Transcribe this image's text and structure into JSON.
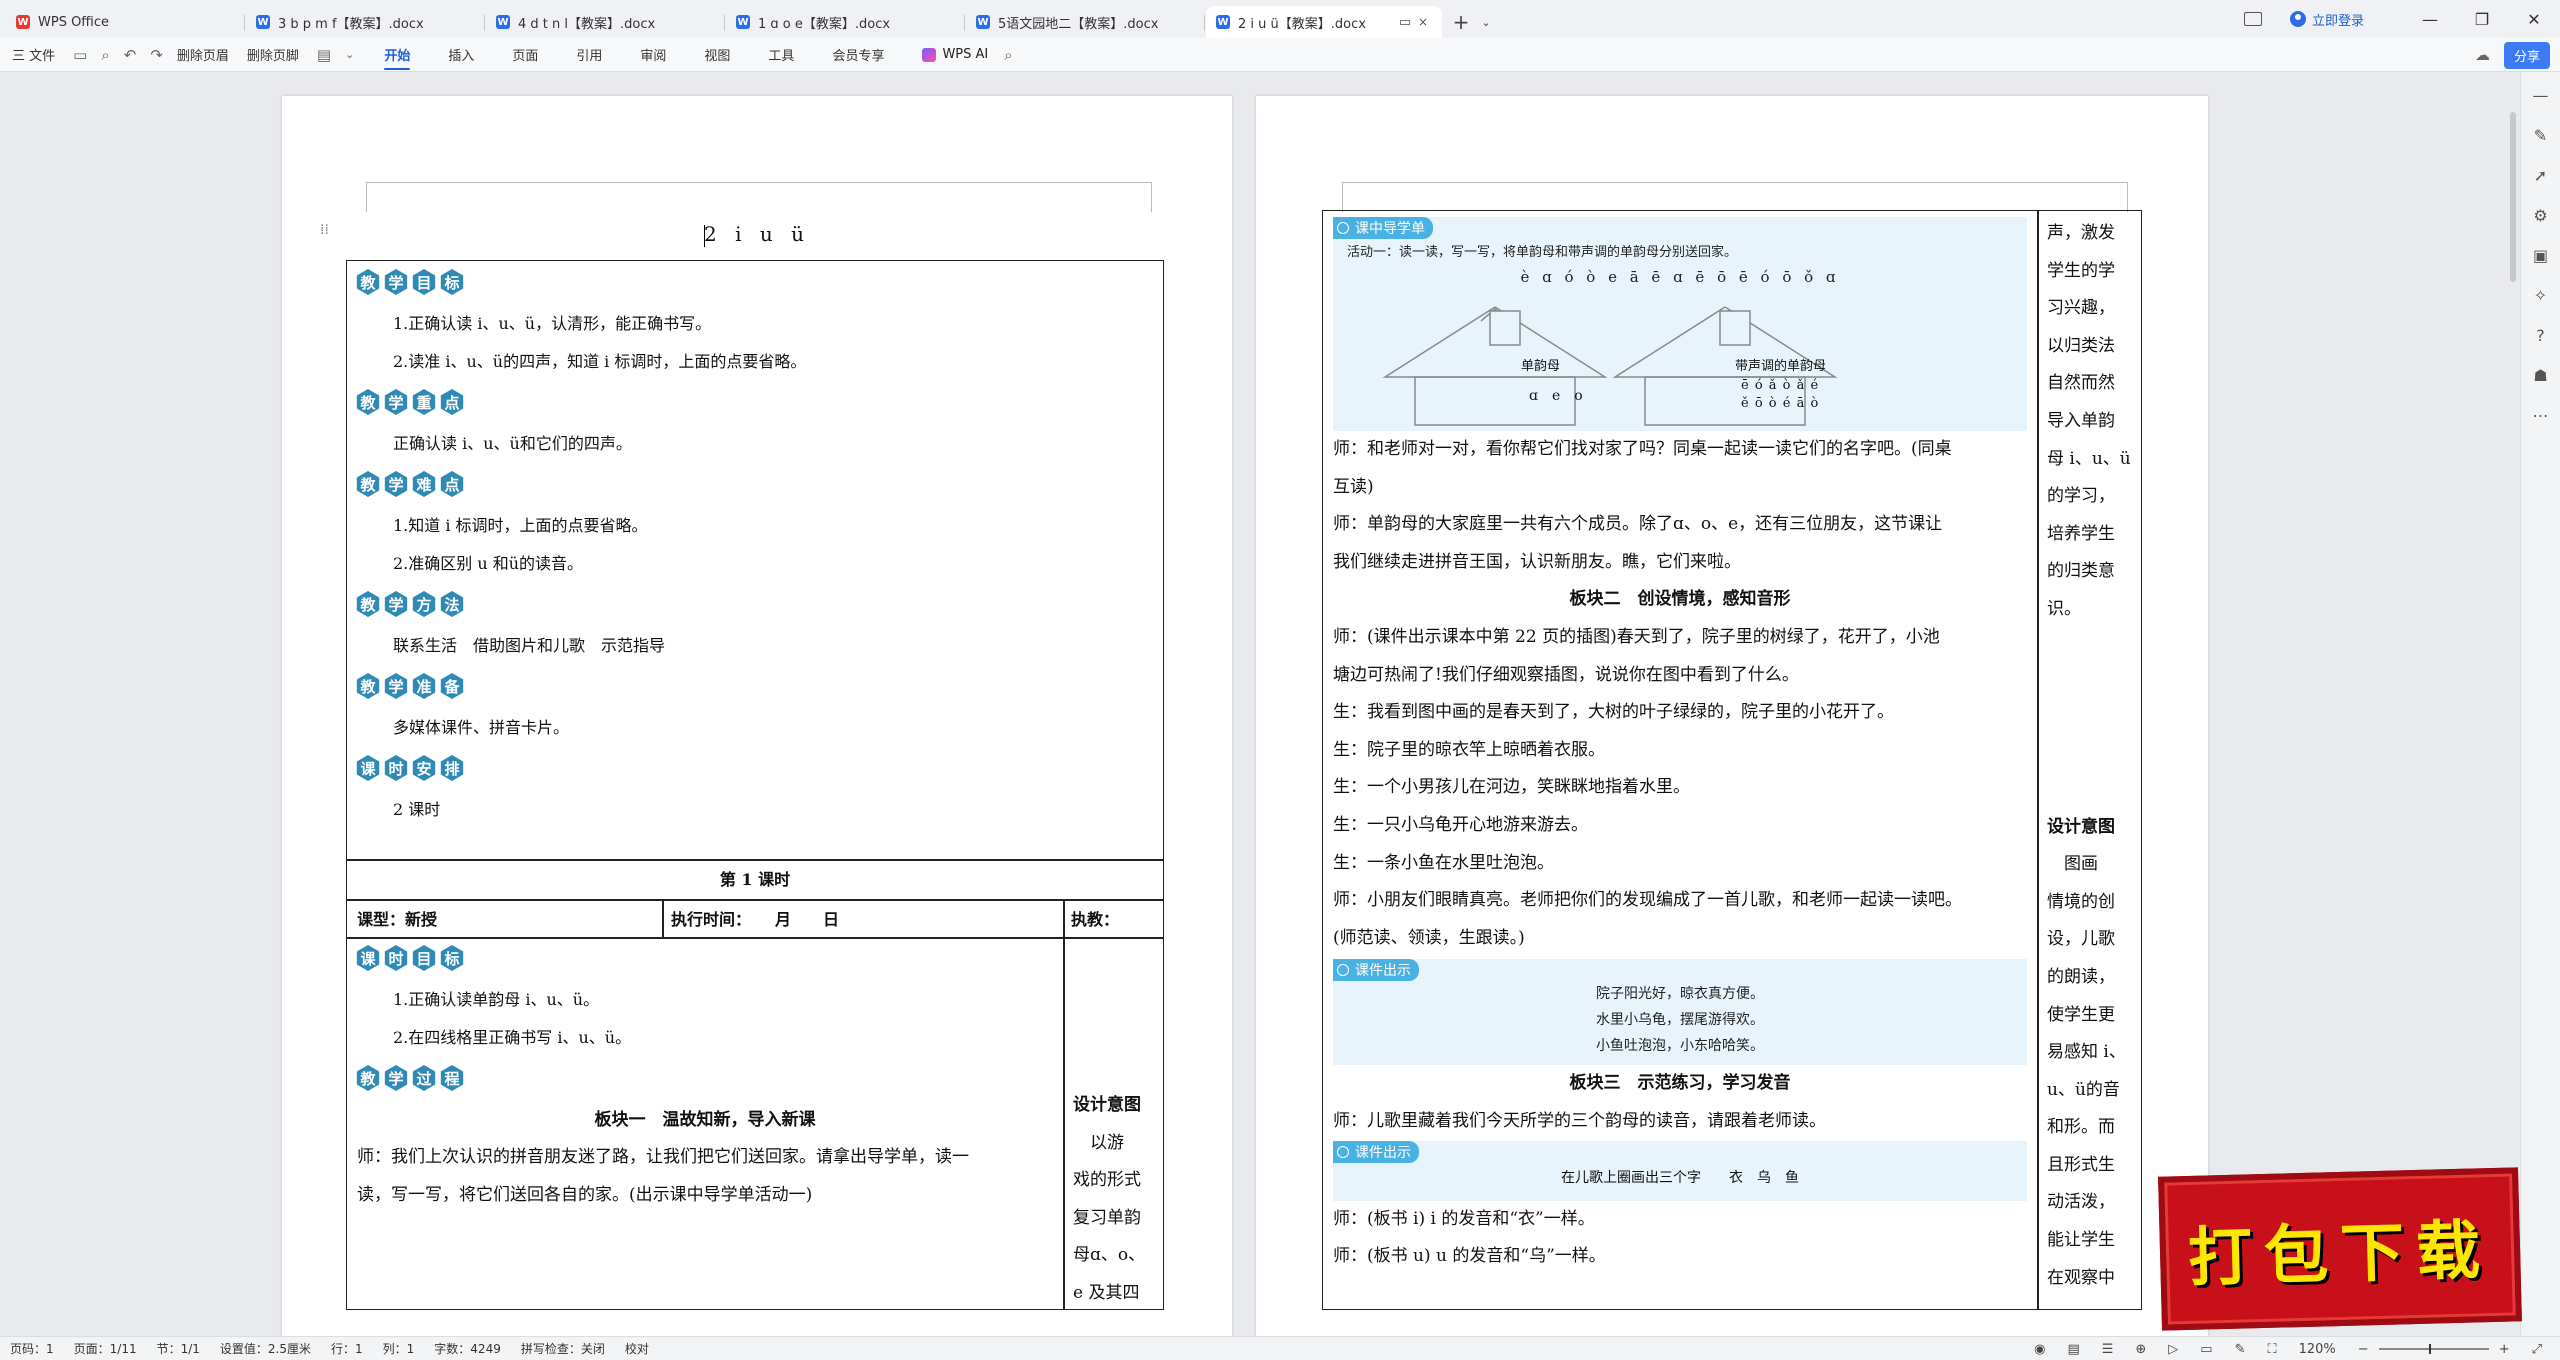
{
  "tabs": [
    {
      "badge": "W",
      "label": "WPS Office",
      "kind": "wps"
    },
    {
      "badge": "W",
      "label": "3 b p m f【教案】.docx",
      "kind": "doc"
    },
    {
      "badge": "W",
      "label": "4 d t n l【教案】.docx",
      "kind": "doc"
    },
    {
      "badge": "W",
      "label": "1 ɑ o e【教案】.docx",
      "kind": "doc"
    },
    {
      "badge": "W",
      "label": "5语文园地二【教案】.docx",
      "kind": "doc"
    },
    {
      "badge": "W",
      "label": "2 i u ü【教案】.docx",
      "kind": "doc",
      "active": true
    }
  ],
  "titlebar": {
    "login": "立即登录",
    "new_tab": "+",
    "tab_menu": "⌄",
    "close": "×"
  },
  "ribbon": {
    "file": "三 文件",
    "delete_header": "删除页眉",
    "delete_footer": "删除页脚",
    "tabs": [
      "开始",
      "插入",
      "页面",
      "引用",
      "审阅",
      "视图",
      "工具",
      "会员专享"
    ],
    "active_tab": "开始",
    "wps_ai": "WPS AI",
    "share": "分享"
  },
  "page1": {
    "title": "2 i u ü",
    "sections": [
      {
        "heading": [
          "教",
          "学",
          "目",
          "标"
        ],
        "lines": [
          "1.正确认读 i、u、ü，认清形，能正确书写。",
          "2.读准 i、u、ü的四声，知道 i 标调时，上面的点要省略。"
        ]
      },
      {
        "heading": [
          "教",
          "学",
          "重",
          "点"
        ],
        "lines": [
          "正确认读 i、u、ü和它们的四声。"
        ]
      },
      {
        "heading": [
          "教",
          "学",
          "难",
          "点"
        ],
        "lines": [
          "1.知道 i 标调时，上面的点要省略。",
          "2.准确区别 u 和ü的读音。"
        ]
      },
      {
        "heading": [
          "教",
          "学",
          "方",
          "法"
        ],
        "lines": [
          "联系生活　借助图片和儿歌　示范指导"
        ]
      },
      {
        "heading": [
          "教",
          "学",
          "准",
          "备"
        ],
        "lines": [
          "多媒体课件、拼音卡片。"
        ]
      },
      {
        "heading": [
          "课",
          "时",
          "安",
          "排"
        ],
        "lines": [
          "2 课时"
        ]
      }
    ],
    "lesson": "第 1 课时",
    "info": {
      "type": "课型：新授",
      "time": "执行时间：　　月　　日",
      "teacher": "执教："
    },
    "lesson_goal_heading": [
      "课",
      "时",
      "目",
      "标"
    ],
    "lesson_goals": [
      "1.正确认读单韵母 i、u、ü。",
      "2.在四线格里正确书写 i、u、ü。"
    ],
    "process_heading": [
      "教",
      "学",
      "过",
      "程"
    ],
    "block1_title": "板块一　温故知新，导入新课",
    "block1_text": [
      "师：我们上次认识的拼音朋友迷了路，让我们把它们送回家。请拿出导学单，读一",
      "读，写一写，将它们送回各自的家。(出示课中导学单活动一)"
    ],
    "side_title": "设计意图",
    "side_text": [
      "　以游",
      "戏的形式",
      "复习单韵",
      "母ɑ、o、",
      "e 及其四"
    ]
  },
  "page2": {
    "guide_label": "课中导学单",
    "activity": "活动一：读一读，写一写，将单韵母和带声调的单韵母分别送回家。",
    "tones": "è ɑ ó ò e ā ē ɑ ē ō ē ó ō ǒ ɑ",
    "house1_title": "单韵母",
    "house1_content": "ɑ　e　o",
    "house2_title": "带声调的单韵母",
    "house2_rows": [
      "ē ó ǎ ò ǎ é",
      "ě ō ò é ā ò"
    ],
    "main_text": [
      {
        "t": "师：和老师对一对，看你帮它们找对家了吗？同桌一起读一读它们的名字吧。(同桌"
      },
      {
        "t": "互读)"
      },
      {
        "t": "师：单韵母的大家庭里一共有六个成员。除了ɑ、o、e，还有三位朋友，这节课让"
      },
      {
        "t": "我们继续走进拼音王国，认识新朋友。瞧，它们来啦。"
      },
      {
        "t": "板块二　创设情境，感知音形",
        "b": true
      },
      {
        "t": "师：(课件出示课本中第 22 页的插图)春天到了，院子里的树绿了，花开了，小池"
      },
      {
        "t": "塘边可热闹了!我们仔细观察插图，说说你在图中看到了什么。"
      },
      {
        "t": "生：我看到图中画的是春天到了，大树的叶子绿绿的，院子里的小花开了。"
      },
      {
        "t": "生：院子里的晾衣竿上晾晒着衣服。"
      },
      {
        "t": "生：一个小男孩儿在河边，笑眯眯地指着水里。"
      },
      {
        "t": "生：一只小乌龟开心地游来游去。"
      },
      {
        "t": "生：一条小鱼在水里吐泡泡。"
      },
      {
        "t": "师：小朋友们眼睛真亮。老师把你们的发现编成了一首儿歌，和老师一起读一读吧。"
      },
      {
        "t": "(师范读、领读，生跟读。)"
      }
    ],
    "courseware_label": "课件出示",
    "poem": [
      "院子阳光好，晾衣真方便。",
      "水里小乌龟，摆尾游得欢。",
      "小鱼吐泡泡，小东哈哈笑。"
    ],
    "block3_title": "板块三　示范练习，学习发音",
    "block3_text": "师：儿歌里藏着我们今天所学的三个韵母的读音，请跟着老师读。",
    "courseware_label2": "课件出示",
    "circle_task": "在儿歌上圈画出三个字　　衣　乌　鱼",
    "end_text": [
      "师：(板书 i) i 的发音和“衣”一样。",
      "师：(板书 u) u 的发音和“乌”一样。"
    ],
    "side_top": [
      "声，激发",
      "学生的学",
      "习兴趣，",
      "以归类法",
      "自然而然",
      "导入单韵",
      "母 i、u、ü",
      "的学习，",
      "培养学生",
      "的归类意",
      "识。"
    ],
    "side_title": "设计意图",
    "side_bottom": [
      "　图画",
      "情境的创",
      "设，儿歌",
      "的朗读，",
      "使学生更",
      "易感知 i、",
      "u、ü的音",
      "和形。而",
      "且形式生",
      "动活泼，",
      "能让学生",
      "在观察中"
    ]
  },
  "status": {
    "page": "页码：1",
    "pages": "页面：1/11",
    "section": "节：1/1",
    "setting": "设置值：2.5厘米",
    "row": "行：1",
    "col": "列：1",
    "words": "字数：4249",
    "spell": "拼写检查：关闭",
    "proof": "校对",
    "zoom": "120%"
  },
  "stamp": {
    "text": "打包下载"
  }
}
